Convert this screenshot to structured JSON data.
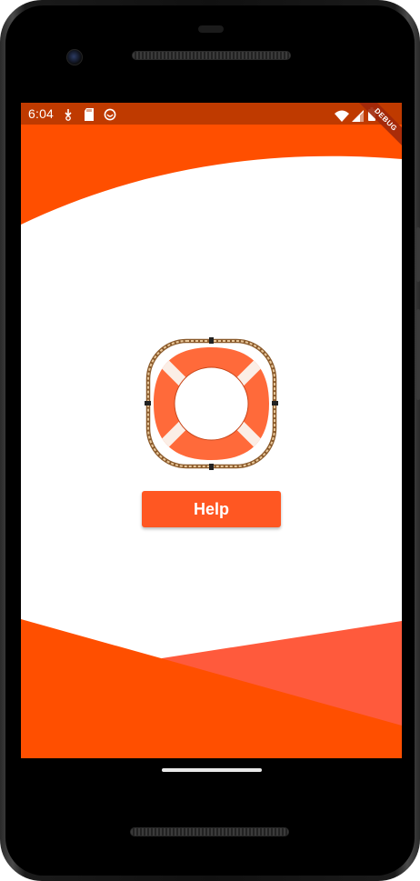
{
  "status_bar": {
    "time": "6:04",
    "left_icons": [
      "download-icon",
      "sd-card-icon",
      "sync-icon"
    ],
    "right_icons": [
      "wifi-icon",
      "cellular-signal-icon",
      "battery-icon"
    ],
    "background_color": "#bf3a00"
  },
  "debug_banner": {
    "label": "DEBUG"
  },
  "main": {
    "logo_icon": "lifebuoy-icon",
    "help_button_label": "Help"
  },
  "colors": {
    "primary": "#ff5722",
    "primary_dark": "#ff4f00",
    "secondary": "#ff5a3c"
  }
}
